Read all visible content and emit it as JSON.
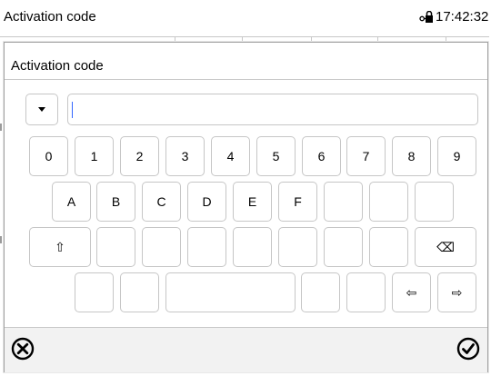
{
  "header": {
    "title": "Activation code",
    "time": "17:42:32"
  },
  "dialog": {
    "title": "Activation code",
    "input": {
      "value": "",
      "placeholder": ""
    }
  },
  "keyboard": {
    "row_digits": [
      "0",
      "1",
      "2",
      "3",
      "4",
      "5",
      "6",
      "7",
      "8",
      "9"
    ],
    "row_hex": [
      "A",
      "B",
      "C",
      "D",
      "E",
      "F"
    ],
    "shift": "⇧",
    "backspace": "⌫",
    "left": "⇦",
    "right": "⇨"
  },
  "icons": {
    "lock": "lock-key-icon",
    "cancel": "cancel-circle-icon",
    "confirm": "confirm-check-icon"
  },
  "colors": {
    "caret": "#3366ff",
    "border": "#c6c6c6",
    "footer_bg": "#f2f2f2"
  }
}
